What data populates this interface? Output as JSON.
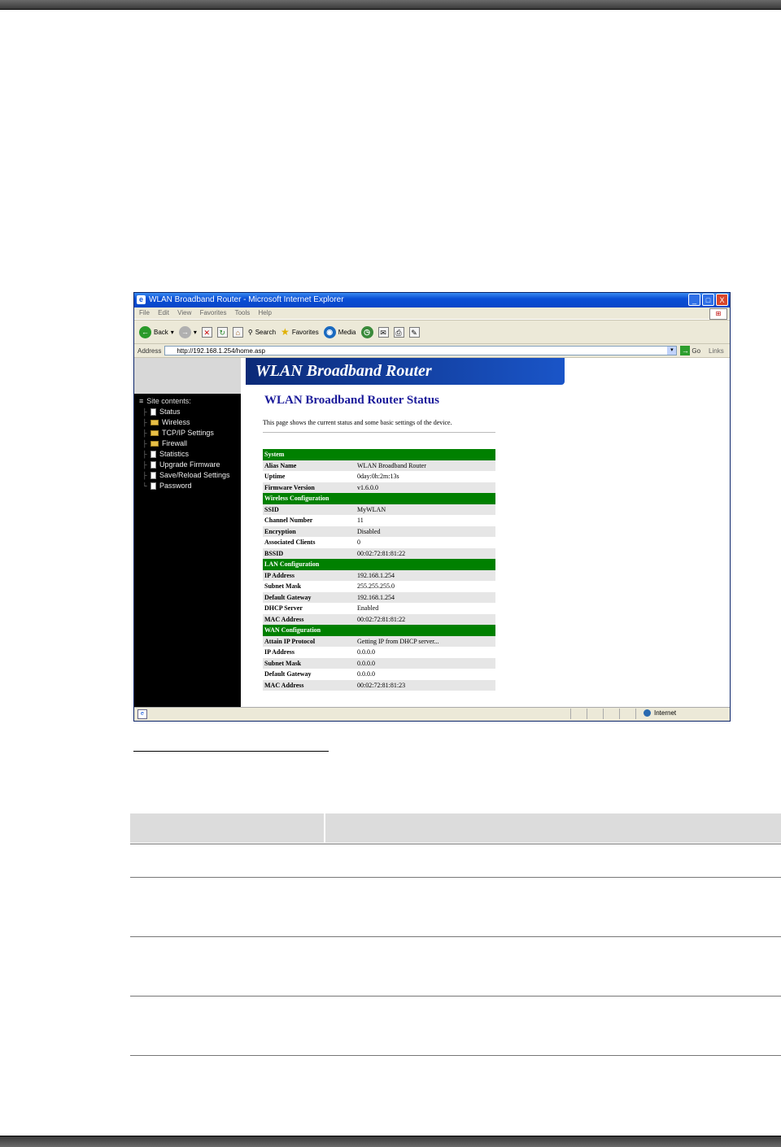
{
  "window": {
    "title": "WLAN Broadband Router - Microsoft Internet Explorer",
    "buttons": {
      "minimize": "_",
      "maximize": "□",
      "close": "X"
    }
  },
  "menu": [
    "File",
    "Edit",
    "View",
    "Favorites",
    "Tools",
    "Help"
  ],
  "toolbar": {
    "back": "Back",
    "search": "Search",
    "favorites": "Favorites",
    "media": "Media"
  },
  "address": {
    "label": "Address",
    "url": "http://192.168.1.254/home.asp",
    "go": "Go",
    "links": "Links"
  },
  "banner": "WLAN Broadband Router",
  "nav": {
    "heading": "Site contents:",
    "items": [
      {
        "label": "Status",
        "type": "page"
      },
      {
        "label": "Wireless",
        "type": "folder"
      },
      {
        "label": "TCP/IP Settings",
        "type": "folder"
      },
      {
        "label": "Firewall",
        "type": "folder"
      },
      {
        "label": "Statistics",
        "type": "page"
      },
      {
        "label": "Upgrade Firmware",
        "type": "page"
      },
      {
        "label": "Save/Reload Settings",
        "type": "page"
      },
      {
        "label": "Password",
        "type": "page"
      }
    ]
  },
  "main": {
    "title": "WLAN Broadband Router Status",
    "description": "This page shows the current status and some basic settings of the device."
  },
  "status": {
    "system": {
      "title": "System",
      "rows": [
        [
          "Alias Name",
          "WLAN Broadband Router"
        ],
        [
          "Uptime",
          "0day:0h:2m:13s"
        ],
        [
          "Firmware Version",
          "v1.6.0.0"
        ]
      ]
    },
    "wireless": {
      "title": "Wireless Configuration",
      "rows": [
        [
          "SSID",
          "MyWLAN"
        ],
        [
          "Channel Number",
          "11"
        ],
        [
          "Encryption",
          "Disabled"
        ],
        [
          "Associated Clients",
          "0"
        ],
        [
          "BSSID",
          "00:02:72:81:81:22"
        ]
      ]
    },
    "lan": {
      "title": "LAN Configuration",
      "rows": [
        [
          "IP Address",
          "192.168.1.254"
        ],
        [
          "Subnet Mask",
          "255.255.255.0"
        ],
        [
          "Default Gateway",
          "192.168.1.254"
        ],
        [
          "DHCP Server",
          "Enabled"
        ],
        [
          "MAC Address",
          "00:02:72:81:81:22"
        ]
      ]
    },
    "wan": {
      "title": "WAN Configuration",
      "rows": [
        [
          "Attain IP Protocol",
          "Getting IP from DHCP server..."
        ],
        [
          "IP Address",
          "0.0.0.0"
        ],
        [
          "Subnet Mask",
          "0.0.0.0"
        ],
        [
          "Default Gateway",
          "0.0.0.0"
        ],
        [
          "MAC Address",
          "00:02:72:81:81:23"
        ]
      ]
    }
  },
  "statusbar": {
    "zone": "Internet"
  }
}
